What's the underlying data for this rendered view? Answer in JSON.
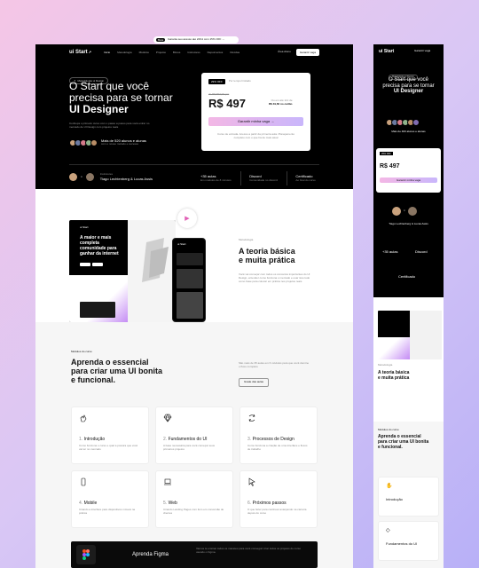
{
  "announce": {
    "badge": "Beta",
    "text": "Garanta seu acesso até 24/11 com 15% OFF →"
  },
  "nav": {
    "logo": "ui Start",
    "links": [
      "Início",
      "Metodologia",
      "Módulos",
      "Projetos",
      "Bônus",
      "Instrutores",
      "Depoimentos",
      "Dúvidas"
    ],
    "login": "Área Aluno",
    "cta": "Garantir vaga"
  },
  "hero": {
    "chip": "Metodologia ui Design",
    "title_line1": "O Start que você",
    "title_line2": "precisa para se tornar",
    "title_bold": "UI Designer",
    "subtitle": "Conheça o primeiro curso com o passo a passo para você entrar no mercado de UI Design com projetos reais",
    "students": "Mais de 520 alunos e alunas",
    "students_sub": "com o nosso método e sucesso"
  },
  "pricing": {
    "badge": "29% OFF",
    "note": "Por tempo limitado",
    "old_price": "de R$ 697,00 por",
    "price": "R$ 497",
    "installments": "Ou em até 12x de",
    "installment_value": "R$ 49,60 no cartão",
    "cta": "Garantir minha vaga →",
    "footer": "Curso de entrada. Acesso a partir da primeira aula. Planejamento completo com o que há de mais atual"
  },
  "instructors": {
    "label": "Instrutores",
    "names": "Tiago Lechtenberg & Lucas Assis"
  },
  "stats": [
    {
      "title": "+35 aulas",
      "sub": "Em módulos de 8 minutos"
    },
    {
      "title": "Discord",
      "sub": "Comunidade no discord"
    },
    {
      "title": "Certificado",
      "sub": "Ao final do curso"
    }
  ],
  "method": {
    "label": "Metodologia",
    "title_line1": "A teoria básica",
    "title_line2": "e muita prática",
    "body": "Você vai começar com todos os conceitos importantes do UI Design, entender como funciona o mercado e usar isso tudo como base para colocar em prática nos projetos reais"
  },
  "mockup": {
    "brand": "ui Start",
    "headline": "A maior e mais completa comunidade para ganhar da internet",
    "badge": "Novidade"
  },
  "modules": {
    "label": "Módulos do curso",
    "title_line1": "Aprenda o essencial",
    "title_line2": "para criar uma UI bonita",
    "title_line3": "e funcional.",
    "desc": "São mais de 35 aulas em 6 módulos para que você domine o fluxo completo",
    "cta": "Grade das aulas",
    "items": [
      {
        "num": "1.",
        "title": "Introdução",
        "desc": "Como funciona o curso e qual a postura que você vai ter no mercado"
      },
      {
        "num": "2.",
        "title": "Fundamentos do UI",
        "desc": "A base necessária para você começar seus primeiros projetos"
      },
      {
        "num": "3.",
        "title": "Processos de Design",
        "desc": "Como funciona a criação de uma interface e fluxos de trabalho"
      },
      {
        "num": "4.",
        "title": "Mobile",
        "desc": "Criando a interface para dispositivos móveis na prática"
      },
      {
        "num": "5.",
        "title": "Web",
        "desc": "Criando Landing Pages com foco em conversão de clientes"
      },
      {
        "num": "6.",
        "title": "Próximos passos",
        "desc": "O que fazer para continuar avançando na carreira depois do curso"
      }
    ]
  },
  "figma": {
    "title": "Aprenda Figma",
    "desc": "Vamos te ensinar todos os macetes para você conseguir criar todos os projetos do curso usando o Figma."
  },
  "mobile": {
    "logo": "ui Start",
    "cta": "Garantir vaga",
    "chip": "Metodologia ui Design",
    "title_line1": "O Start que você",
    "title_line2": "precisa para se tornar",
    "title_bold": "UI Designer",
    "students": "Mais de 400 alunos e alunas",
    "badge": "29% OFF",
    "price": "R$ 497",
    "button": "Garantir minha vaga",
    "instructors": "Tiago Lechtenberg & Lucas Assis",
    "stat1": "+35 aulas",
    "stat2": "Discord",
    "stat3": "Certificado",
    "method_label": "Metodologia",
    "method_title1": "A teoria básica",
    "method_title2": "e muita prática",
    "modules_label": "Módulos do curso",
    "modules_title1": "Aprenda o essencial",
    "modules_title2": "para criar uma UI bonita",
    "modules_title3": "e funcional.",
    "mod1": "Introdução",
    "mod2": "Fundamentos do UI"
  }
}
